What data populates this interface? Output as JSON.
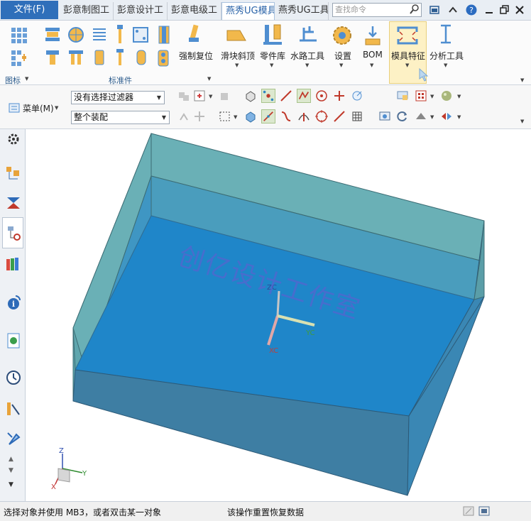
{
  "tabs": {
    "file": "文件(F)",
    "items": [
      "彭意制图工",
      "彭意设计工",
      "彭意电级工",
      "燕秀UG模具",
      "燕秀UG工具"
    ],
    "active_index": 3
  },
  "search": {
    "placeholder": "查找命令"
  },
  "ribbon": {
    "group_icons_label": "图标",
    "group_std_label": "标准件",
    "force_reset": "强制复位",
    "buttons": [
      "滑块斜顶",
      "零件库",
      "水路工具",
      "设置",
      "BOM",
      "模具特征",
      "分析工具"
    ]
  },
  "selection": {
    "menu_label": "菜单(M)",
    "filter_value": "没有选择过滤器",
    "assembly_value": "整个装配"
  },
  "viewport": {
    "watermark": "创亿设计工作室",
    "triad": {
      "zc": "ZC",
      "xc": "XC",
      "yc": "YC"
    },
    "axes": {
      "x": "X",
      "y": "Y",
      "z": "Z"
    }
  },
  "status": {
    "left": "选择对象并使用 MB3，或者双击某一对象",
    "right": "该操作重置恢复数据"
  },
  "colors": {
    "accent": "#2f6fba",
    "block_top": "#5a9ea8",
    "block_front": "#3a7f9c",
    "block_inner": "#1f86c9"
  }
}
